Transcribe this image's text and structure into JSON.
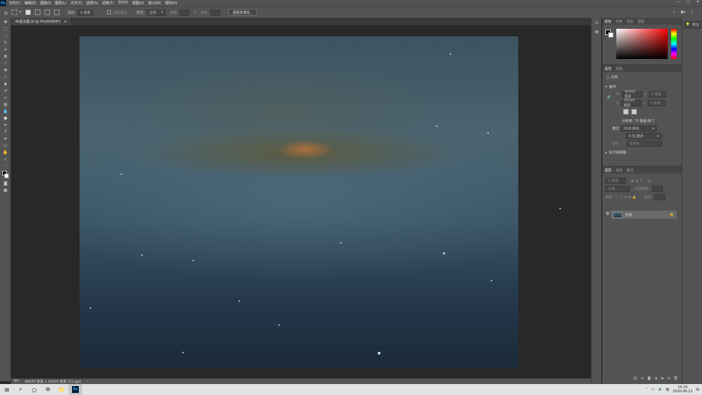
{
  "app": {
    "logo": "Ps"
  },
  "menu": [
    "文件(F)",
    "编辑(E)",
    "图像(I)",
    "图层(L)",
    "文字(Y)",
    "选择(S)",
    "滤镜(T)",
    "3D(D)",
    "视图(V)",
    "窗口(W)",
    "帮助(H)"
  ],
  "window_controls": {
    "minimize": "—",
    "maximize": "▢",
    "close": "✕"
  },
  "options": {
    "feather_label": "羽化:",
    "feather_value": "0 像素",
    "antialias_label": "消除锯齿",
    "style_label": "样式:",
    "style_value": "正常",
    "width_label": "宽度:",
    "height_label": "高度:",
    "select_subject_button": "选择并遮住..."
  },
  "document": {
    "tab_title": "40星云图.tif @ 4%(RGB/8*)",
    "tab_close": "×"
  },
  "status": {
    "zoom": "4%",
    "info": "40000 像素 x 30105 像素 (72 ppi)",
    "arrow": "›"
  },
  "panels": {
    "color_tabs": [
      "颜色",
      "色板",
      "渐变",
      "图案"
    ],
    "props_tabs": [
      "属性",
      "调整"
    ],
    "props": {
      "doc_label": "文档",
      "canvas_section": "画布",
      "w_label": "W",
      "w_value": "40000 像素",
      "x_label": "X",
      "x_value": "0 像素",
      "h_label": "H",
      "h_value": "30105 像素",
      "y_label": "Y",
      "y_value": "0 像素",
      "resolution": "分辨率: 72 像素/英寸",
      "mode_label": "模式",
      "mode_value": "RGB 颜色",
      "depth_value": "8 位/通道",
      "fill_label": "填充",
      "fill_value": "背景色",
      "guides_section": "标尺和网格"
    },
    "layers_tabs": [
      "图层",
      "通道",
      "路径"
    ],
    "layers": {
      "search_kind": "Q 类型",
      "blend_mode": "正常",
      "opacity_label": "不透明度:",
      "lock_label": "锁定:",
      "fill_label": "填充:",
      "layer_name": "背景"
    }
  },
  "learn": {
    "label": "学习"
  },
  "taskbar": {
    "start": "⊞",
    "search": "⌕",
    "cortana": "○",
    "taskview": "⧉",
    "explorer": "📁",
    "ps": "Ps",
    "time": "15:16",
    "date": "2020-06-12"
  }
}
